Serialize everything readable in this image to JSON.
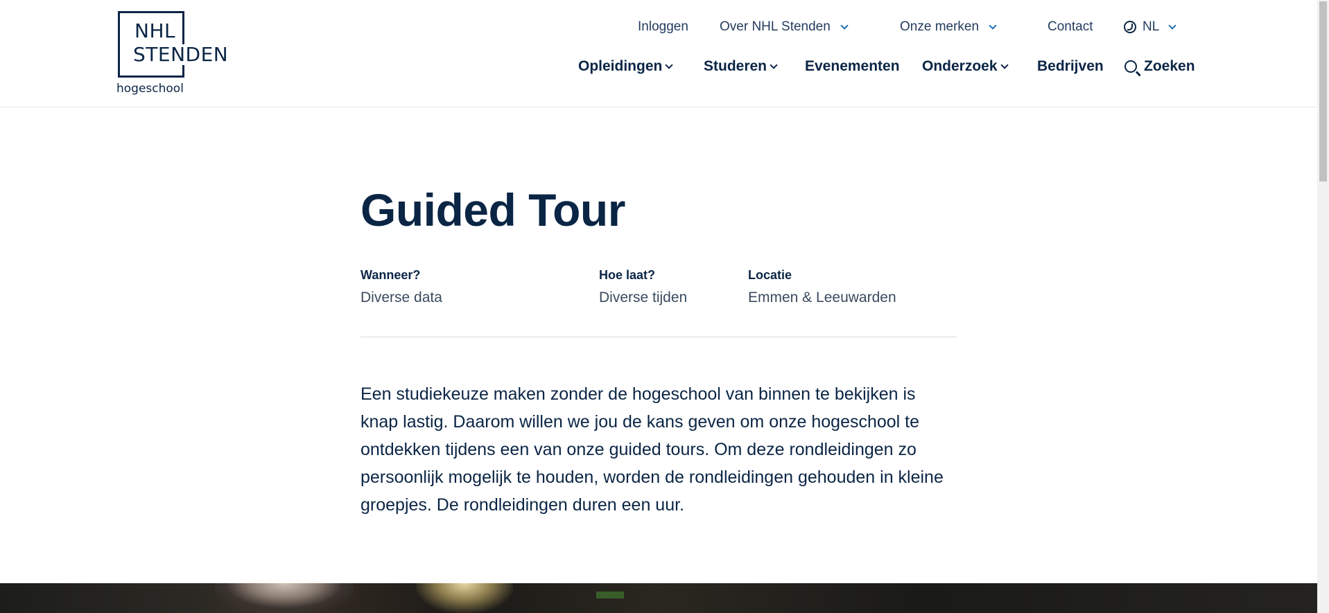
{
  "header": {
    "logo": {
      "line1": "NHL",
      "line2": "STENDEN",
      "sub": "hogeschool"
    },
    "top_nav": [
      {
        "label": "Inloggen",
        "dropdown": false
      },
      {
        "label": "Over NHL Stenden",
        "dropdown": true
      },
      {
        "label": "Onze merken",
        "dropdown": true
      },
      {
        "label": "Contact",
        "dropdown": false
      }
    ],
    "language": {
      "label": "NL",
      "icon": "globe-icon"
    },
    "main_nav": [
      {
        "label": "Opleidingen",
        "dropdown": true
      },
      {
        "label": "Studeren",
        "dropdown": true
      },
      {
        "label": "Evenementen",
        "dropdown": false
      },
      {
        "label": "Onderzoek",
        "dropdown": true
      },
      {
        "label": "Bedrijven",
        "dropdown": false
      }
    ],
    "search": {
      "label": "Zoeken",
      "icon": "search-icon"
    }
  },
  "page": {
    "title": "Guided Tour",
    "meta": [
      {
        "label": "Wanneer?",
        "value": "Diverse data"
      },
      {
        "label": "Hoe laat?",
        "value": "Diverse tijden"
      },
      {
        "label": "Locatie",
        "value": "Emmen & Leeuwarden"
      }
    ],
    "intro": "Een studiekeuze maken zonder de hogeschool van binnen te bekijken is knap lastig. Daarom willen we jou de kans geven om onze hogeschool te ontdekken tijdens een van onze guided tours. Om deze rondleidingen zo persoonlijk mogelijk te houden, worden de rondleidingen gehouden in kleine groepjes. De rondleidingen duren een uur."
  },
  "colors": {
    "brand_navy": "#0b2545",
    "accent_blue": "#1a6fb5",
    "divider": "#d7dbe0"
  }
}
